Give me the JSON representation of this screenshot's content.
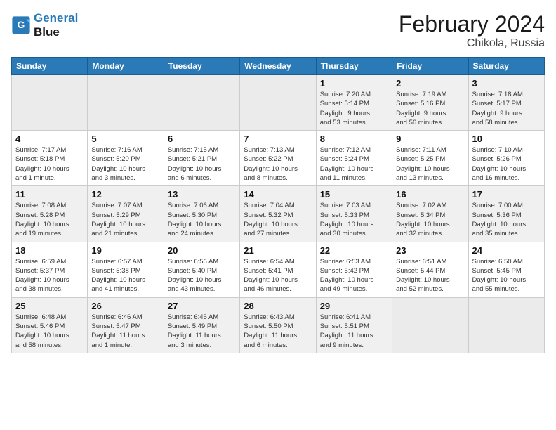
{
  "header": {
    "logo_line1": "General",
    "logo_line2": "Blue",
    "month": "February 2024",
    "location": "Chikola, Russia"
  },
  "weekdays": [
    "Sunday",
    "Monday",
    "Tuesday",
    "Wednesday",
    "Thursday",
    "Friday",
    "Saturday"
  ],
  "weeks": [
    [
      {
        "day": "",
        "info": ""
      },
      {
        "day": "",
        "info": ""
      },
      {
        "day": "",
        "info": ""
      },
      {
        "day": "",
        "info": ""
      },
      {
        "day": "1",
        "info": "Sunrise: 7:20 AM\nSunset: 5:14 PM\nDaylight: 9 hours\nand 53 minutes."
      },
      {
        "day": "2",
        "info": "Sunrise: 7:19 AM\nSunset: 5:16 PM\nDaylight: 9 hours\nand 56 minutes."
      },
      {
        "day": "3",
        "info": "Sunrise: 7:18 AM\nSunset: 5:17 PM\nDaylight: 9 hours\nand 58 minutes."
      }
    ],
    [
      {
        "day": "4",
        "info": "Sunrise: 7:17 AM\nSunset: 5:18 PM\nDaylight: 10 hours\nand 1 minute."
      },
      {
        "day": "5",
        "info": "Sunrise: 7:16 AM\nSunset: 5:20 PM\nDaylight: 10 hours\nand 3 minutes."
      },
      {
        "day": "6",
        "info": "Sunrise: 7:15 AM\nSunset: 5:21 PM\nDaylight: 10 hours\nand 6 minutes."
      },
      {
        "day": "7",
        "info": "Sunrise: 7:13 AM\nSunset: 5:22 PM\nDaylight: 10 hours\nand 8 minutes."
      },
      {
        "day": "8",
        "info": "Sunrise: 7:12 AM\nSunset: 5:24 PM\nDaylight: 10 hours\nand 11 minutes."
      },
      {
        "day": "9",
        "info": "Sunrise: 7:11 AM\nSunset: 5:25 PM\nDaylight: 10 hours\nand 13 minutes."
      },
      {
        "day": "10",
        "info": "Sunrise: 7:10 AM\nSunset: 5:26 PM\nDaylight: 10 hours\nand 16 minutes."
      }
    ],
    [
      {
        "day": "11",
        "info": "Sunrise: 7:08 AM\nSunset: 5:28 PM\nDaylight: 10 hours\nand 19 minutes."
      },
      {
        "day": "12",
        "info": "Sunrise: 7:07 AM\nSunset: 5:29 PM\nDaylight: 10 hours\nand 21 minutes."
      },
      {
        "day": "13",
        "info": "Sunrise: 7:06 AM\nSunset: 5:30 PM\nDaylight: 10 hours\nand 24 minutes."
      },
      {
        "day": "14",
        "info": "Sunrise: 7:04 AM\nSunset: 5:32 PM\nDaylight: 10 hours\nand 27 minutes."
      },
      {
        "day": "15",
        "info": "Sunrise: 7:03 AM\nSunset: 5:33 PM\nDaylight: 10 hours\nand 30 minutes."
      },
      {
        "day": "16",
        "info": "Sunrise: 7:02 AM\nSunset: 5:34 PM\nDaylight: 10 hours\nand 32 minutes."
      },
      {
        "day": "17",
        "info": "Sunrise: 7:00 AM\nSunset: 5:36 PM\nDaylight: 10 hours\nand 35 minutes."
      }
    ],
    [
      {
        "day": "18",
        "info": "Sunrise: 6:59 AM\nSunset: 5:37 PM\nDaylight: 10 hours\nand 38 minutes."
      },
      {
        "day": "19",
        "info": "Sunrise: 6:57 AM\nSunset: 5:38 PM\nDaylight: 10 hours\nand 41 minutes."
      },
      {
        "day": "20",
        "info": "Sunrise: 6:56 AM\nSunset: 5:40 PM\nDaylight: 10 hours\nand 43 minutes."
      },
      {
        "day": "21",
        "info": "Sunrise: 6:54 AM\nSunset: 5:41 PM\nDaylight: 10 hours\nand 46 minutes."
      },
      {
        "day": "22",
        "info": "Sunrise: 6:53 AM\nSunset: 5:42 PM\nDaylight: 10 hours\nand 49 minutes."
      },
      {
        "day": "23",
        "info": "Sunrise: 6:51 AM\nSunset: 5:44 PM\nDaylight: 10 hours\nand 52 minutes."
      },
      {
        "day": "24",
        "info": "Sunrise: 6:50 AM\nSunset: 5:45 PM\nDaylight: 10 hours\nand 55 minutes."
      }
    ],
    [
      {
        "day": "25",
        "info": "Sunrise: 6:48 AM\nSunset: 5:46 PM\nDaylight: 10 hours\nand 58 minutes."
      },
      {
        "day": "26",
        "info": "Sunrise: 6:46 AM\nSunset: 5:47 PM\nDaylight: 11 hours\nand 1 minute."
      },
      {
        "day": "27",
        "info": "Sunrise: 6:45 AM\nSunset: 5:49 PM\nDaylight: 11 hours\nand 3 minutes."
      },
      {
        "day": "28",
        "info": "Sunrise: 6:43 AM\nSunset: 5:50 PM\nDaylight: 11 hours\nand 6 minutes."
      },
      {
        "day": "29",
        "info": "Sunrise: 6:41 AM\nSunset: 5:51 PM\nDaylight: 11 hours\nand 9 minutes."
      },
      {
        "day": "",
        "info": ""
      },
      {
        "day": "",
        "info": ""
      }
    ]
  ]
}
